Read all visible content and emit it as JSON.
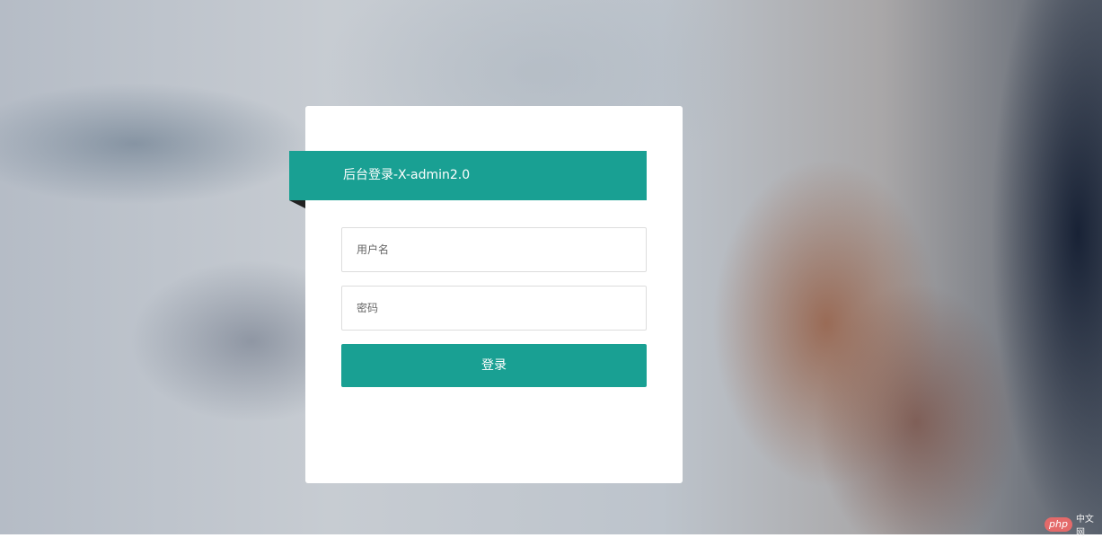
{
  "login": {
    "title": "后台登录-X-admin2.0",
    "username_placeholder": "用户名",
    "password_placeholder": "密码",
    "submit_label": "登录"
  },
  "watermark": {
    "logo": "php",
    "site": "中文网"
  },
  "colors": {
    "accent": "#19a093",
    "card": "#ffffff",
    "fold": "#222222"
  }
}
